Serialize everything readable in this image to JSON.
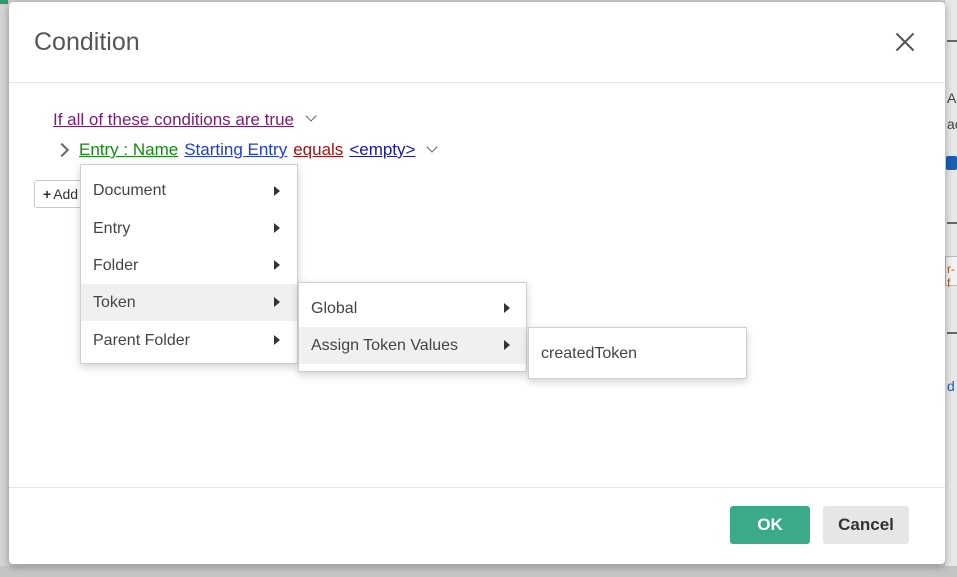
{
  "dialog": {
    "title": "Condition",
    "close_icon": "close-icon"
  },
  "condition": {
    "header": "If all of these conditions are true",
    "row": {
      "field": "Entry : Name",
      "target": "Starting Entry",
      "operator": "equals",
      "value": "<empty>"
    },
    "add_label": "Add"
  },
  "menus": {
    "level1": [
      "Document",
      "Entry",
      "Folder",
      "Token",
      "Parent Folder"
    ],
    "level2": [
      "Global",
      "Assign Token Values"
    ],
    "level3": [
      "createdToken"
    ]
  },
  "footer": {
    "ok_label": "OK",
    "cancel_label": "Cancel"
  },
  "background": {
    "right_fragments": [
      "A",
      "ac",
      "r-f",
      "d"
    ]
  },
  "colors": {
    "ok_button": "#3aaa88",
    "header_link": "#7a1f6e",
    "field_link": "#148a14",
    "target_link": "#1f3fc8",
    "operator_link": "#a01414"
  }
}
